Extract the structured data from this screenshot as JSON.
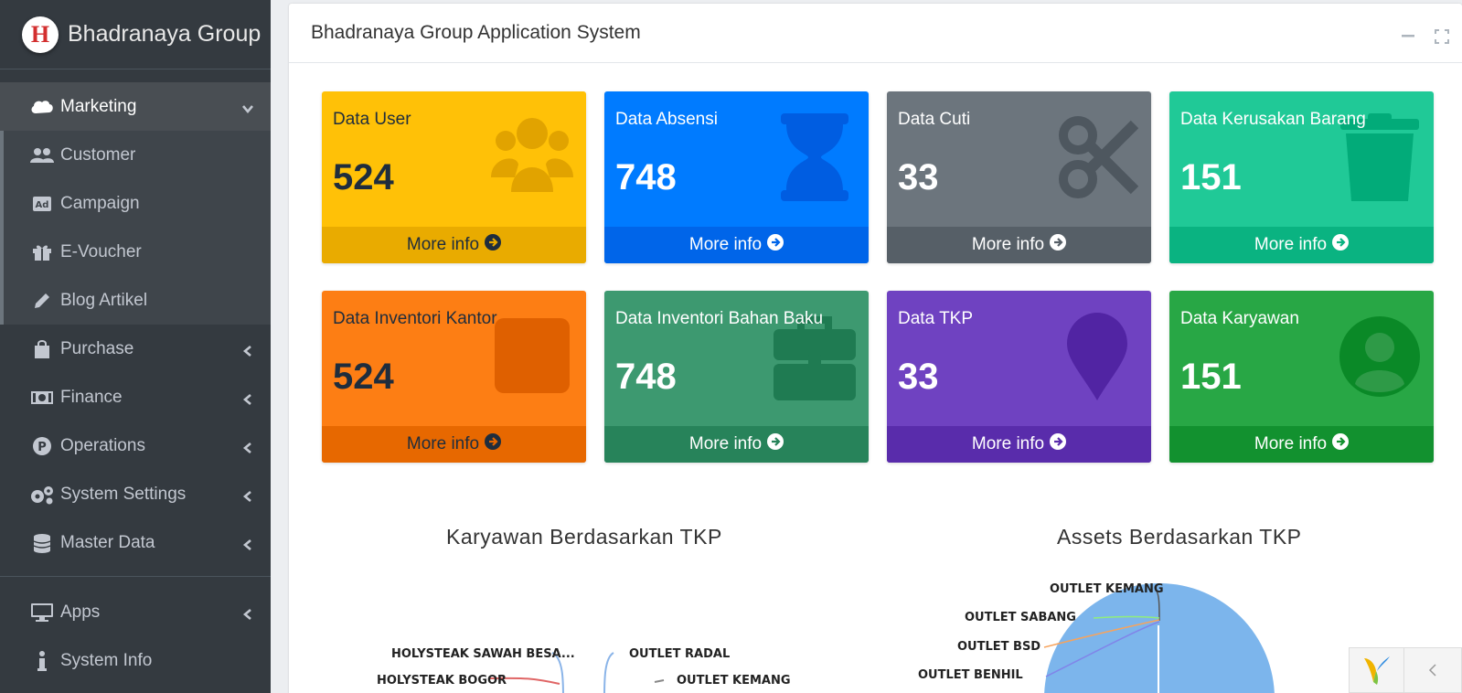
{
  "brand": {
    "logo_letter": "H",
    "name": "Bhadranaya Group"
  },
  "sidebar": {
    "items": [
      {
        "label": "Marketing",
        "icon": "salesforce-cloud-icon"
      },
      {
        "label": "Customer",
        "icon": "users-icon"
      },
      {
        "label": "Campaign",
        "icon": "ad-icon"
      },
      {
        "label": "E-Voucher",
        "icon": "gift-icon"
      },
      {
        "label": "Blog Artikel",
        "icon": "pencil-icon"
      },
      {
        "label": "Purchase",
        "icon": "shopping-bag-icon"
      },
      {
        "label": "Finance",
        "icon": "money-bill-icon"
      },
      {
        "label": "Operations",
        "icon": "parking-icon"
      },
      {
        "label": "System Settings",
        "icon": "cogs-icon"
      },
      {
        "label": "Master Data",
        "icon": "database-icon"
      },
      {
        "label": "Apps",
        "icon": "desktop-icon"
      },
      {
        "label": "System Info",
        "icon": "info-icon"
      }
    ]
  },
  "header": {
    "title": "Bhadranaya Group Application System"
  },
  "boxes": [
    {
      "title": "Data User",
      "value": "524",
      "footer": "More info",
      "color": "#ffc107",
      "icon": "users-icon"
    },
    {
      "title": "Data Absensi",
      "value": "748",
      "footer": "More info",
      "color": "#007bff",
      "icon": "hourglass-icon"
    },
    {
      "title": "Data Cuti",
      "value": "33",
      "footer": "More info",
      "color": "#6c757d",
      "icon": "scissors-icon"
    },
    {
      "title": "Data Kerusakan Barang",
      "value": "151",
      "footer": "More info",
      "color": "#20c997",
      "icon": "trash-icon"
    },
    {
      "title": "Data Inventori Kantor",
      "value": "524",
      "footer": "More info",
      "color": "#fd7e14",
      "icon": "square-icon"
    },
    {
      "title": "Data Inventori Bahan Baku",
      "value": "748",
      "footer": "More info",
      "color": "#3d9970",
      "icon": "briefcase-icon"
    },
    {
      "title": "Data TKP",
      "value": "33",
      "footer": "More info",
      "color": "#6f42c1",
      "icon": "map-marker-icon"
    },
    {
      "title": "Data Karyawan",
      "value": "151",
      "footer": "More info",
      "color": "#28a745",
      "icon": "user-circle-icon"
    }
  ],
  "charts": {
    "left_title": "Karyawan Berdasarkan TKP",
    "left_labels": [
      "HOLYSTEAK SAWAH BESA...",
      "HOLYSTEAK BOGOR",
      "OUTLET RADAL",
      "OUTLET KEMANG"
    ],
    "right_title": "Assets Berdasarkan TKP",
    "right_labels": [
      "OUTLET KEMANG",
      "OUTLET SABANG",
      "OUTLET BSD",
      "OUTLET BENHIL"
    ]
  }
}
